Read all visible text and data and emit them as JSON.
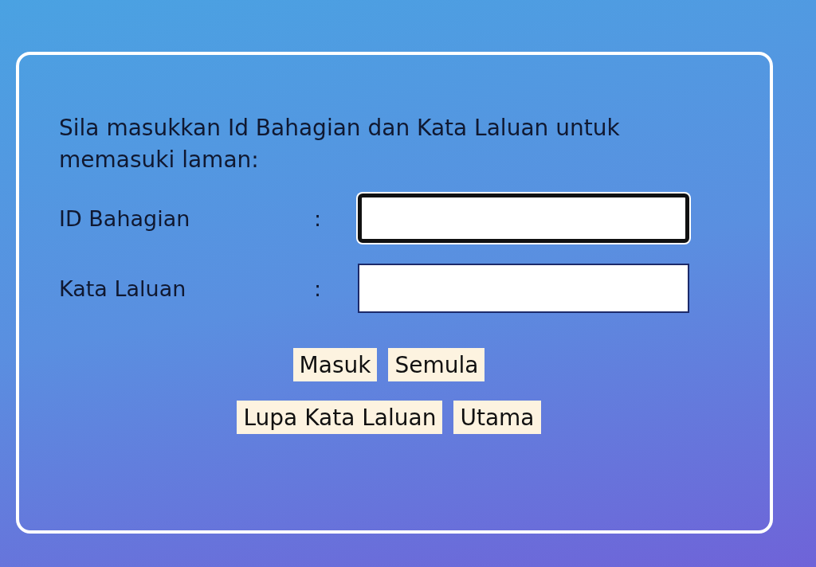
{
  "instruction": "Sila masukkan Id Bahagian dan Kata Laluan untuk memasuki laman:",
  "fields": [
    {
      "label": "ID Bahagian",
      "separator": ":",
      "focused": true
    },
    {
      "label": "Kata Laluan",
      "separator": ":",
      "focused": false
    }
  ],
  "button_rows": [
    [
      "Masuk",
      "Semula"
    ],
    [
      "Lupa Kata Laluan",
      "Utama"
    ]
  ]
}
